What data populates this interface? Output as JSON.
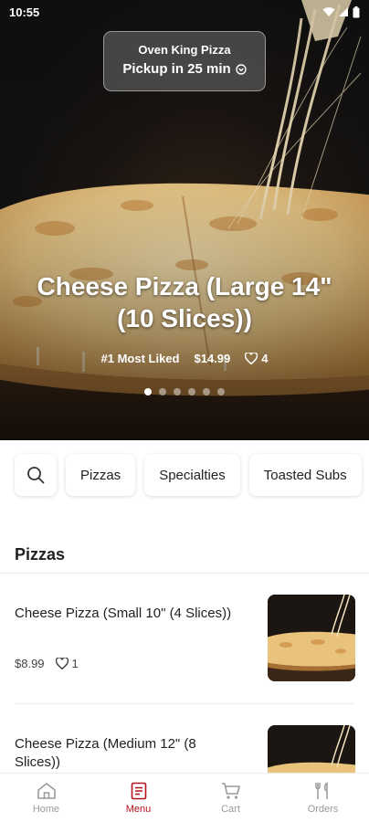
{
  "status_bar": {
    "time": "10:55"
  },
  "store": {
    "name": "Oven King Pizza",
    "pickup": "Pickup in 25 min"
  },
  "featured": {
    "title": "Cheese Pizza (Large 14\" (10 Slices))",
    "badge": "#1 Most Liked",
    "price": "$14.99",
    "likes": "4",
    "carousel_pages": 6,
    "carousel_active": 0
  },
  "categories": [
    "Pizzas",
    "Specialties",
    "Toasted Subs"
  ],
  "section": {
    "title": "Pizzas"
  },
  "items": [
    {
      "name": "Cheese Pizza (Small 10\" (4 Slices))",
      "price": "$8.99",
      "likes": "1"
    },
    {
      "name": "Cheese Pizza (Medium 12\" (8 Slices))",
      "price": "",
      "likes": ""
    }
  ],
  "nav": [
    {
      "label": "Home",
      "icon": "home-icon"
    },
    {
      "label": "Menu",
      "icon": "menu-icon",
      "active": true
    },
    {
      "label": "Cart",
      "icon": "cart-icon"
    },
    {
      "label": "Orders",
      "icon": "orders-icon"
    }
  ],
  "colors": {
    "accent": "#b5121b",
    "nav_inactive": "#9a9a9a"
  }
}
